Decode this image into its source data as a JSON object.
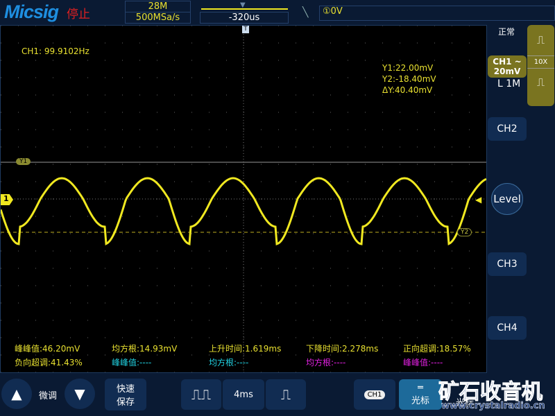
{
  "header": {
    "brand": "Micsig",
    "run_state": "停止",
    "memory_depth": "28M",
    "sample_rate": "500MSa/s",
    "horizontal_position": "-320us",
    "trigger_edge_icon": "falling-edge-icon",
    "trigger_level": "①0V"
  },
  "screen": {
    "frequency": "CH1: 99.9102Hz",
    "cursor_y1": "Y1:22.00mV",
    "cursor_y2": "Y2:-18.40mV",
    "cursor_delta": "ΔY:40.40mV",
    "y1_label": "Y1",
    "y2_label": "Y2",
    "ch_marker": "1",
    "trace_color": "#f0e820"
  },
  "measurements": {
    "row1": [
      {
        "text": "峰峰值:46.20mV",
        "color": "#e8e030"
      },
      {
        "text": "均方根:14.93mV",
        "color": "#e8e030"
      },
      {
        "text": "上升时间:1.619ms",
        "color": "#e8e030"
      },
      {
        "text": "下降时间:2.278ms",
        "color": "#e8e030"
      },
      {
        "text": "正向超调:18.57%",
        "color": "#e8e030"
      }
    ],
    "row2": [
      {
        "text": "负向超调:41.43%",
        "color": "#e8e030"
      },
      {
        "text": "峰峰值:----",
        "color": "#20d0e0"
      },
      {
        "text": "均方根:----",
        "color": "#20d0e0"
      },
      {
        "text": "均方根:----",
        "color": "#e020e0"
      },
      {
        "text": "峰峰值:----",
        "color": "#e020e0"
      }
    ]
  },
  "right_panel": {
    "acq_mode": "正常",
    "ch1_label": "CH1 ~",
    "ch1_scale": "20mV",
    "probe": "10X",
    "impedance": "L 1M",
    "ch2": "CH2",
    "level": "Level",
    "ch3": "CH3",
    "ch4": "CH4"
  },
  "bottom": {
    "fine": "微调",
    "fast_save": "快速\n保存",
    "timebase": "4ms",
    "ch1": "CH1",
    "cursor": "光标",
    "cursor2": "光标",
    "watermark": "矿石收音机",
    "watermark_url": "www.crystalradio.cn"
  }
}
